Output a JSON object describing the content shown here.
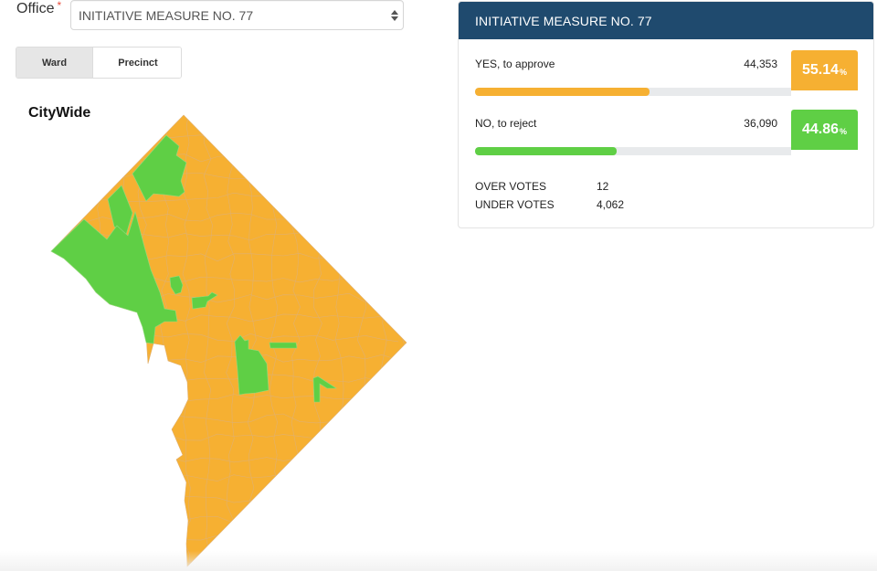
{
  "filters": {
    "office_label": "Office",
    "required_marker": "*",
    "office_selected": "INITIATIVE MEASURE NO. 77",
    "view_toggle": [
      {
        "label": "Ward",
        "active": true
      },
      {
        "label": "Precinct",
        "active": false
      }
    ]
  },
  "map": {
    "title": "CityWide",
    "colors": {
      "yes": "#f6b032",
      "no": "#5fcf45",
      "border": "#e0b070"
    }
  },
  "results": {
    "title": "INITIATIVE MEASURE NO. 77",
    "choices": [
      {
        "name": "YES, to approve",
        "votes": "44,353",
        "percent": "55.14",
        "percent_value": 55.14,
        "unit": "%",
        "color": "#f6b032"
      },
      {
        "name": "NO, to reject",
        "votes": "36,090",
        "percent": "44.86",
        "percent_value": 44.86,
        "unit": "%",
        "color": "#5fcf45"
      }
    ],
    "extra": [
      {
        "label": "OVER VOTES",
        "value": "12"
      },
      {
        "label": "UNDER VOTES",
        "value": "4,062"
      }
    ]
  }
}
